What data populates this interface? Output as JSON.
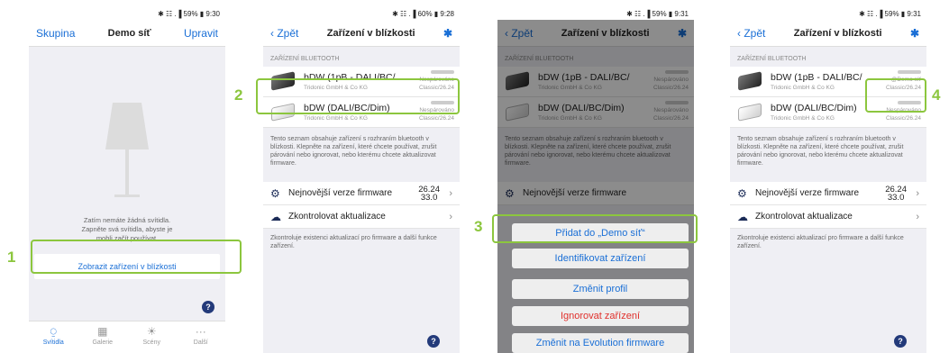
{
  "statusbars": [
    "✱ ☷ .▐ 59% ▮ 9:30",
    "✱ ☷ .▐ 60% ▮ 9:28",
    "✱ ☷ .▐ 59% ▮ 9:31",
    "✱ ☷ .▐ 59% ▮ 9:31"
  ],
  "colors": {
    "accent": "#1a6fd6",
    "callout": "#8cc63e",
    "danger": "#e0302c",
    "navy": "#233a7a"
  },
  "callouts": {
    "n1": "1",
    "n2": "2",
    "n3": "3",
    "n4": "4"
  },
  "s1": {
    "left": "Skupina",
    "title": "Demo síť",
    "right": "Upravit",
    "empty_text": "Zatím nemáte žádná svítidla. Zapněte svá svítidla, abyste je mohli začít používat.",
    "button": "Zobrazit zařízení v blízkosti",
    "help": "?",
    "tabs": [
      {
        "label": "Svítidla",
        "icon": "lamp-icon"
      },
      {
        "label": "Galerie",
        "icon": "grid-icon"
      },
      {
        "label": "Scény",
        "icon": "sun-icon"
      },
      {
        "label": "Další",
        "icon": "more-icon"
      }
    ]
  },
  "s2": {
    "back": "‹ Zpět",
    "title": "Zařízení v blízkosti",
    "bt": "✱",
    "section": "ZAŘÍZENÍ BLUETOOTH",
    "devices": [
      {
        "name": "bDW (1pB - DALI/BC/",
        "maker": "Tridonic GmbH & Co KG",
        "status": "Nespárováno",
        "version": "Classic/26.24"
      },
      {
        "name": "bDW (DALI/BC/Dim)",
        "maker": "Tridonic GmbH & Co KG",
        "status": "Nespárováno",
        "version": "Classic/26.24"
      }
    ],
    "info": "Tento seznam obsahuje zařízení s rozhraním bluetooth v blízkosti. Klepněte na zařízení, které chcete používat, zrušit párování nebo ignorovat, nebo kterému chcete aktualizovat firmware.",
    "fw_label": "Nejnovější verze firmware",
    "fw_v1": "26.24",
    "fw_v2": "33.0",
    "upd_label": "Zkontrolovat aktualizace",
    "note": "Zkontroluje existenci aktualizací pro firmware a další funkce zařízení.",
    "help": "?"
  },
  "s3": {
    "fw_label_partial": "Nejnovější verze firmware",
    "sheet": {
      "add": "Přidat do „Demo síť“",
      "identify": "Identifikovat zařízení",
      "profile": "Změnit profil",
      "ignore": "Ignorovat zařízení",
      "evolution": "Změnit na Evolution firmware"
    }
  },
  "s4": {
    "dev1_status": "@Demo síť"
  }
}
